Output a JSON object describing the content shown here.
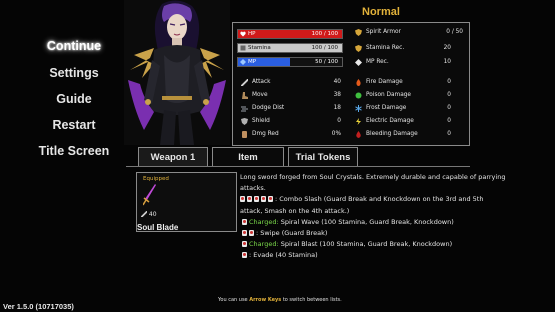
{
  "menu": {
    "items": [
      {
        "label": "Continue",
        "active": true
      },
      {
        "label": "Settings",
        "active": false
      },
      {
        "label": "Guide",
        "active": false
      },
      {
        "label": "Restart",
        "active": false
      },
      {
        "label": "Title Screen",
        "active": false
      }
    ]
  },
  "version": "Ver 1.5.0 (10717035)",
  "difficulty": "Normal",
  "bars": [
    {
      "label": "HP",
      "value": "100 / 100",
      "fill": 1.0,
      "color": "#d01a1a"
    },
    {
      "label": "Stamina",
      "value": "100 / 100",
      "fill": 1.0,
      "color": "#d8d8d8"
    },
    {
      "label": "MP",
      "value": "50 / 100",
      "fill": 0.5,
      "color": "#2a5ee0"
    }
  ],
  "spirit_armor": {
    "label": "Spirit Armor",
    "value": "0 / 50"
  },
  "recovery": [
    {
      "label": "Stamina Rec.",
      "value": "20"
    },
    {
      "label": "MP Rec.",
      "value": "10"
    }
  ],
  "stats_left": [
    {
      "label": "Attack",
      "value": "40",
      "icon": "sword-icon",
      "color": "#d0d0d0"
    },
    {
      "label": "Move",
      "value": "38",
      "icon": "boot-icon",
      "color": "#b08a5a"
    },
    {
      "label": "Dodge Dist",
      "value": "18",
      "icon": "dash-icon",
      "color": "#9aa0a8"
    },
    {
      "label": "Shield",
      "value": "0",
      "icon": "shield-icon",
      "color": "#b0b0b0"
    },
    {
      "label": "Dmg Red",
      "value": "0%",
      "icon": "armor-icon",
      "color": "#c09060"
    }
  ],
  "stats_right": [
    {
      "label": "Fire Damage",
      "value": "0",
      "icon": "fire-icon",
      "color": "#e55a1a"
    },
    {
      "label": "Poison Damage",
      "value": "0",
      "icon": "poison-icon",
      "color": "#3fbf3f"
    },
    {
      "label": "Frost Damage",
      "value": "0",
      "icon": "frost-icon",
      "color": "#5aa8e8"
    },
    {
      "label": "Electric Damage",
      "value": "0",
      "icon": "electric-icon",
      "color": "#e8d23a"
    },
    {
      "label": "Bleeding Damage",
      "value": "0",
      "icon": "blood-icon",
      "color": "#c21f1f"
    }
  ],
  "tabs": [
    {
      "label": "Weapon 1",
      "active": true
    },
    {
      "label": "Item",
      "active": false
    },
    {
      "label": "Trial Tokens",
      "active": false
    }
  ],
  "weapon": {
    "status": "Equipped",
    "attack": "40",
    "name": "Soul Blade",
    "description": [
      "Long sword forged from Soul Crystals. Extremely durable and capable of parrying",
      "attacks."
    ],
    "combo": {
      "text": ": Combo Slash (Guard Break and Knockdown on the 3rd and 5th",
      "cont": "attack, Smash on the 4th attack.)"
    },
    "moves": [
      {
        "charged": "Charged:",
        "text": " Spiral Wave (100 Stamina, Guard Break, Knockdown)"
      },
      {
        "charged": "",
        "text": ": Swipe (Guard Break)"
      },
      {
        "charged": "Charged:",
        "text": " Spiral Blast (100 Stamina, Guard Break, Knockdown)"
      },
      {
        "charged": "",
        "text": ": Evade (40 Stamina)"
      }
    ]
  },
  "hint": {
    "pre": "You can use ",
    "keys": "Arrow Keys",
    "post": " to switch between lists."
  },
  "colors": {
    "accent": "#e2b23a",
    "charged": "#7ad84a",
    "panel_border": "#8a8a8a"
  }
}
